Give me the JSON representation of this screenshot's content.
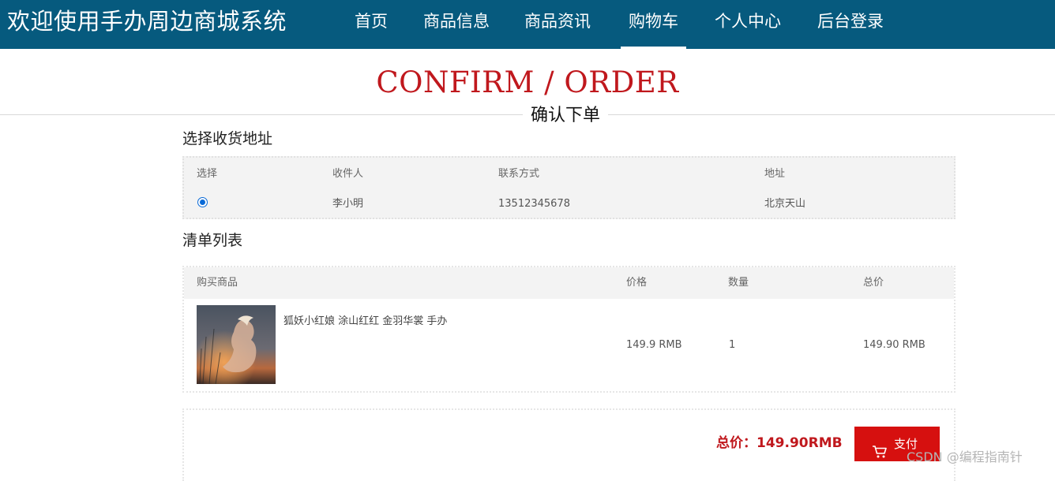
{
  "header": {
    "brand": "欢迎使用手办周边商城系统",
    "nav": [
      "首页",
      "商品信息",
      "商品资讯",
      "购物车",
      "个人中心",
      "后台登录"
    ],
    "active_index": 3
  },
  "page": {
    "title_en": "CONFIRM / ORDER",
    "title_cn": "确认下单"
  },
  "address": {
    "title": "选择收货地址",
    "columns": [
      "选择",
      "收件人",
      "联系方式",
      "地址"
    ],
    "rows": [
      {
        "selected": true,
        "name": "李小明",
        "phone": "13512345678",
        "address": "北京天山"
      }
    ]
  },
  "items": {
    "title": "清单列表",
    "columns": [
      "购买商品",
      "价格",
      "数量",
      "总价"
    ],
    "rows": [
      {
        "name": "狐妖小红娘 涂山红红 金羽华裳 手办",
        "price": "149.9 RMB",
        "qty": "1",
        "total": "149.90 RMB"
      }
    ]
  },
  "summary": {
    "total_label": "总价：149.90RMB",
    "pay_label": "支付"
  },
  "watermark": "CSDN @编程指南针",
  "colors": {
    "header_bg": "#065a7e",
    "accent_red": "#c0181d",
    "pay_btn": "#d6100f",
    "radio": "#0a6ad7"
  },
  "icons": {
    "cart": "shopping-cart-icon",
    "radio": "radio-selected"
  }
}
